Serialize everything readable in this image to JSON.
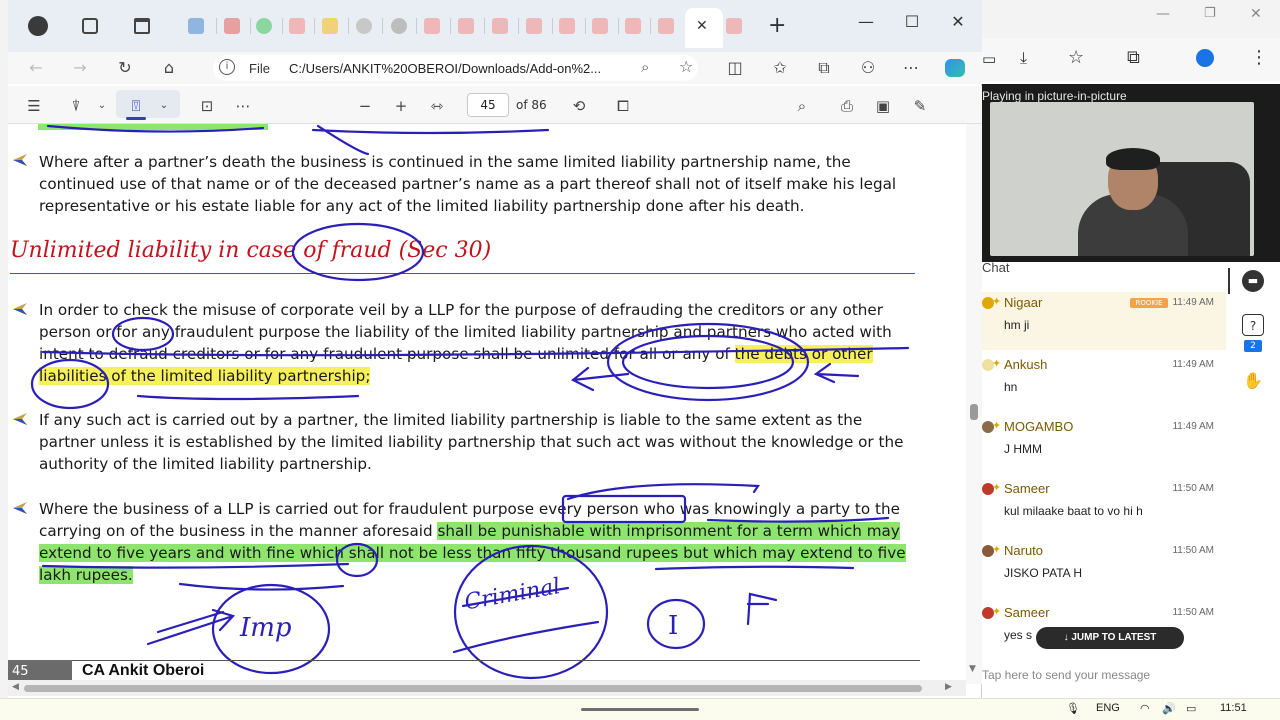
{
  "browser": {
    "file_label": "File",
    "url": "C:/Users/ANKIT%20OBEROI/Downloads/Add-on%2...",
    "close_tab": "✕",
    "new_tab": "+",
    "minimize": "—",
    "maximize": "☐",
    "close": "✕"
  },
  "pdf_toolbar": {
    "page_current": "45",
    "page_total": "of 86"
  },
  "document": {
    "para1": "Where after a partner’s death the business is continued in the same limited liability partnership name, the continued use of that name or of the deceased partner’s name as a part thereof shall not of itself make his legal representative or his estate liable for any act of the limited liability partnership done after his death.",
    "heading": "Unlimited liability in case of fraud (Sec 30)",
    "para2_a": "In order to check the misuse of corporate veil by a LLP for the purpose of defrauding the creditors or any other person or for any fraudulent purpose the liability of the limited liability partnership and partners who acted with intent to defraud creditors or for any fraudulent purpose shall be unlimited for all or any of ",
    "para2_b": "the debts or other liabilities of the limited liability partnership;",
    "para3": "If any such act is carried out by a partner, the limited liability partnership is liable to the same extent as the partner unless it is established by the limited liability partnership that such act was without the knowledge or the authority of the limited liability partnership.",
    "para4_a": "Where the business of a LLP is carried out for fraudulent purpose every person who was knowingly a party to the carrying on of the business in the manner aforesaid ",
    "para4_b": "shall be punishable with imprisonment for a term which may extend to five years and with fine which shall not be less than fifty thousand rupees but which may extend to five lakh rupees.",
    "footer_page": "45",
    "footer_author": "CA Ankit Oberoi"
  },
  "annotations": {
    "imp": "Imp",
    "criminal": "Criminal",
    "letter": "I"
  },
  "side_panel": {
    "pip_label": "Playing in picture-in-picture",
    "chat_label": "Chat",
    "jump_latest": "↓  JUMP TO LATEST",
    "input_placeholder": "Tap here to send your message",
    "badge_count": "2",
    "messages": [
      {
        "name": "Nigaar",
        "time": "11:49 AM",
        "text": "hm ji",
        "badge": "ROOKIE",
        "color": "#e0a800"
      },
      {
        "name": "Ankush",
        "time": "11:49 AM",
        "text": "hn",
        "color": "#e0a800"
      },
      {
        "name": "MOGAMBO",
        "time": "11:49 AM",
        "text": "J HMM",
        "color": "#8a6b4a"
      },
      {
        "name": "Sameer",
        "time": "11:50 AM",
        "text": "kul milaake baat to vo hi h",
        "color": "#c0392b"
      },
      {
        "name": "Naruto",
        "time": "11:50 AM",
        "text": "JISKO PATA H",
        "color": "#8a5a3a"
      },
      {
        "name": "Sameer",
        "time": "11:50 AM",
        "text": "yes s",
        "color": "#c0392b"
      }
    ]
  },
  "taskbar": {
    "lang": "ENG",
    "clock": "11:51"
  },
  "colors": {
    "highlight_yellow": "#f6f05a",
    "highlight_green": "#8ee56e",
    "ink_blue": "#2a1fb8",
    "heading_red": "#c0131b"
  }
}
